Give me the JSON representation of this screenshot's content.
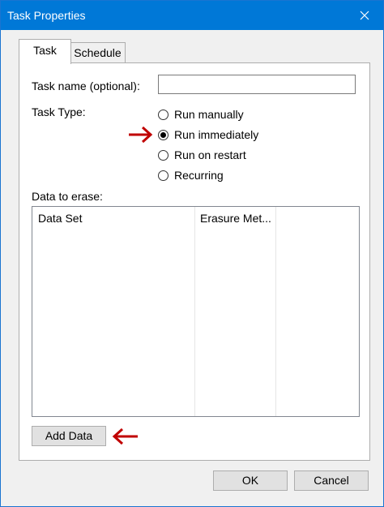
{
  "window": {
    "title": "Task Properties"
  },
  "tabs": [
    {
      "label": "Task",
      "active": true
    },
    {
      "label": "Schedule",
      "active": false
    }
  ],
  "task": {
    "name_label": "Task name (optional):",
    "name_value": "",
    "type_label": "Task Type:",
    "type_options": [
      {
        "label": "Run manually",
        "selected": false
      },
      {
        "label": "Run immediately",
        "selected": true
      },
      {
        "label": "Run on restart",
        "selected": false
      },
      {
        "label": "Recurring",
        "selected": false
      }
    ],
    "data_label": "Data to erase:",
    "columns": [
      "Data Set",
      "Erasure Met..."
    ],
    "add_data_label": "Add Data"
  },
  "footer": {
    "ok_label": "OK",
    "cancel_label": "Cancel"
  },
  "colors": {
    "titlebar": "#0078d7",
    "annotation_arrow": "#c00000"
  },
  "icons": {
    "close": "close-icon",
    "arrow": "red-arrow-annotation-icon"
  }
}
